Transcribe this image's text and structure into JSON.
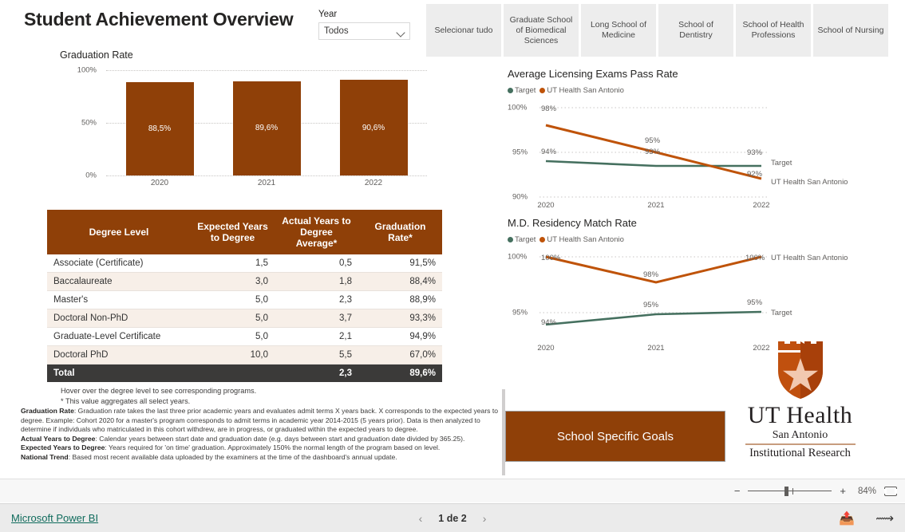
{
  "report": {
    "title": "Student Achievement Overview"
  },
  "slicer": {
    "label": "Year",
    "value": "Todos"
  },
  "schools": [
    {
      "label": "Selecionar tudo"
    },
    {
      "label": "Graduate School of Biomedical Sciences"
    },
    {
      "label": "Long School of Medicine"
    },
    {
      "label": "School of Dentistry"
    },
    {
      "label": "School of Health Professions"
    },
    {
      "label": "School of Nursing"
    }
  ],
  "matrix": {
    "headers": [
      "Degree Level",
      "Expected Years to Degree",
      "Actual Years to Degree Average*",
      "Graduation Rate*"
    ],
    "rows": [
      {
        "level": "Associate (Certificate)",
        "expected": "1,5",
        "actual": "0,5",
        "rate": "91,5%"
      },
      {
        "level": "Baccalaureate",
        "expected": "3,0",
        "actual": "1,8",
        "rate": "88,4%"
      },
      {
        "level": "Master's",
        "expected": "5,0",
        "actual": "2,3",
        "rate": "88,9%"
      },
      {
        "level": "Doctoral Non-PhD",
        "expected": "5,0",
        "actual": "3,7",
        "rate": "93,3%"
      },
      {
        "level": "Graduate-Level Certificate",
        "expected": "5,0",
        "actual": "2,1",
        "rate": "94,9%"
      },
      {
        "level": "Doctoral PhD",
        "expected": "10,0",
        "actual": "5,5",
        "rate": "67,0%"
      }
    ],
    "total": {
      "level": "Total",
      "expected": "",
      "actual": "2,3",
      "rate": "89,6%"
    }
  },
  "notes": {
    "hover": "Hover over the degree level to see corresponding programs.",
    "asterisk": "* This value aggregates all select years.",
    "grad_label": "Graduation Rate",
    "grad_text": ": Graduation rate takes the last three prior academic years and evaluates admit terms X years back. X corresponds to the expected years to degree. Example: Cohort 2020 for a master's program corresponds to admit terms in academic year 2014-2015 (5 years prior). Data is then analyzed to determine if individuals who matriculated in this cohort withdrew, are in progress, or graduated within the expected years to degree.",
    "actual_label": "Actual Years to Degree",
    "actual_text": ": Calendar years between start date and graduation date (e.g. days between start and graduation date divided by 365.25).",
    "expected_label": "Expected Years to Degree",
    "expected_text": ": Years required for 'on time' graduation. Approximately 150% the normal length of the program based on level.",
    "national_label": "National Trend",
    "national_text": ": Based most recent available data uploaded by the examiners at the time of the dashboard's annual update."
  },
  "goals_button": {
    "label": "School Specific Goals"
  },
  "logo": {
    "ut": "UT Health",
    "san_antonio": "San Antonio",
    "institutional_research": "Institutional Research"
  },
  "zoombar": {
    "minus": "−",
    "plus": "+",
    "percent": "84%"
  },
  "footer": {
    "link": "Microsoft Power BI",
    "prev": "‹",
    "page": "1 de 2",
    "next": "›"
  },
  "colors": {
    "brand_brown": "#8F4008",
    "target_green": "#45705F",
    "ut_orange": "#BF5309",
    "header_dark": "#3B3A39",
    "alt_row": "#F7EFE8"
  },
  "chart_data": [
    {
      "type": "bar",
      "title": "Graduation Rate",
      "categories": [
        "2020",
        "2021",
        "2022"
      ],
      "values": [
        88.5,
        89.6,
        90.6
      ],
      "value_labels": [
        "88,5%",
        "89,6%",
        "90,6%"
      ],
      "ytick_labels": [
        "100%",
        "50%",
        "0%"
      ],
      "yticks": [
        100,
        50,
        0
      ],
      "ylim": [
        0,
        100
      ],
      "xlabel": "",
      "ylabel": "",
      "grid": true,
      "series_color": "#8F4008"
    },
    {
      "type": "line",
      "title": "Average Licensing Exams Pass Rate",
      "categories": [
        "2020",
        "2021",
        "2022"
      ],
      "ytick_labels": [
        "100%",
        "95%",
        "90%"
      ],
      "yticks": [
        100,
        95,
        90
      ],
      "ylim": [
        90,
        100
      ],
      "grid": true,
      "legend": [
        "Target",
        "UT Health San Antonio"
      ],
      "legend_position": "top-left",
      "series": [
        {
          "name": "Target",
          "color": "#45705F",
          "values": [
            94,
            93,
            93
          ],
          "labels": [
            "94%",
            "93%",
            "93%"
          ],
          "end_label": "Target"
        },
        {
          "name": "UT Health San Antonio",
          "color": "#BF5309",
          "values": [
            98,
            95,
            92
          ],
          "labels": [
            "98%",
            "95%",
            "92%"
          ],
          "end_label": "UT Health San Antonio"
        }
      ]
    },
    {
      "type": "line",
      "title": "M.D. Residency Match Rate",
      "categories": [
        "2020",
        "2021",
        "2022"
      ],
      "ytick_labels": [
        "100%",
        "95%"
      ],
      "yticks": [
        100,
        95
      ],
      "ylim": [
        93,
        100.5
      ],
      "grid": true,
      "legend": [
        "Target",
        "UT Health San Antonio"
      ],
      "legend_position": "top-left",
      "series": [
        {
          "name": "Target",
          "color": "#45705F",
          "values": [
            94,
            95,
            95
          ],
          "labels": [
            "94%",
            "95%",
            "95%"
          ],
          "end_label": "Target"
        },
        {
          "name": "UT Health San Antonio",
          "color": "#BF5309",
          "values": [
            100,
            98,
            100
          ],
          "labels": [
            "100%",
            "98%",
            "100%"
          ],
          "end_label": "UT Health San Antonio"
        }
      ]
    }
  ]
}
